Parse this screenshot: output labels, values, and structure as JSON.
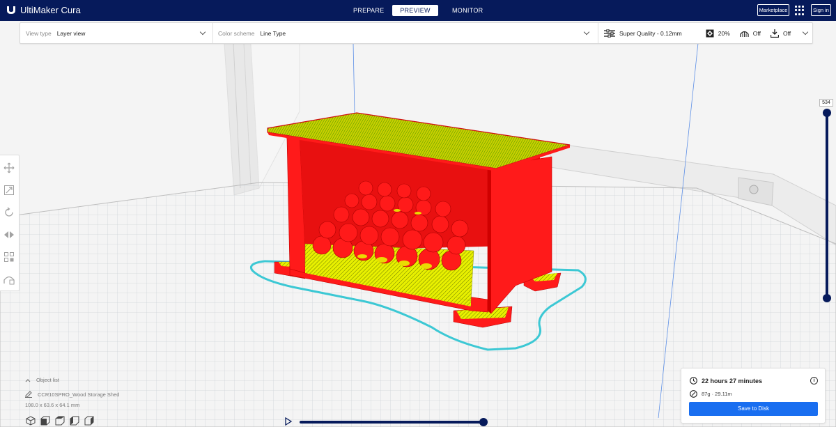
{
  "app": {
    "title": "UltiMaker Cura"
  },
  "stages": {
    "prepare": "PREPARE",
    "preview": "PREVIEW",
    "monitor": "MONITOR"
  },
  "header": {
    "marketplace": "Marketplace",
    "signin": "Sign in"
  },
  "options": {
    "view_type_label": "View type",
    "view_type_value": "Layer view",
    "color_scheme_label": "Color scheme",
    "color_scheme_value": "Line Type",
    "quality": "Super Quality - 0.12mm",
    "infill": "20%",
    "support": "Off",
    "adhesion": "Off"
  },
  "layer": {
    "current": "534",
    "progress": 1.0
  },
  "object_list": {
    "header": "Object list",
    "object_name": "CCR10SPRO_Wood Storage Shed",
    "dimensions": "108.0 x 63.6 x 64.1 mm"
  },
  "print": {
    "time": "22 hours 27 minutes",
    "material": "87g · 29.11m",
    "save_label": "Save to Disk"
  },
  "playback": {
    "progress": 1.0
  },
  "colors": {
    "brand_navy": "#061a5b",
    "accent_blue": "#196ef0",
    "wall_red": "#ff1a1a",
    "infill_yellow": "#e8f000",
    "skirt_cyan": "#3cc8d4"
  },
  "icons": {
    "logo": "ultimaker-logo-icon",
    "apps": "apps-grid-icon",
    "quality": "sliders-icon",
    "infill": "infill-icon",
    "support": "support-icon",
    "adhesion": "adhesion-icon",
    "clock": "clock-icon",
    "material": "spool-icon",
    "info": "info-icon",
    "play": "play-icon"
  }
}
